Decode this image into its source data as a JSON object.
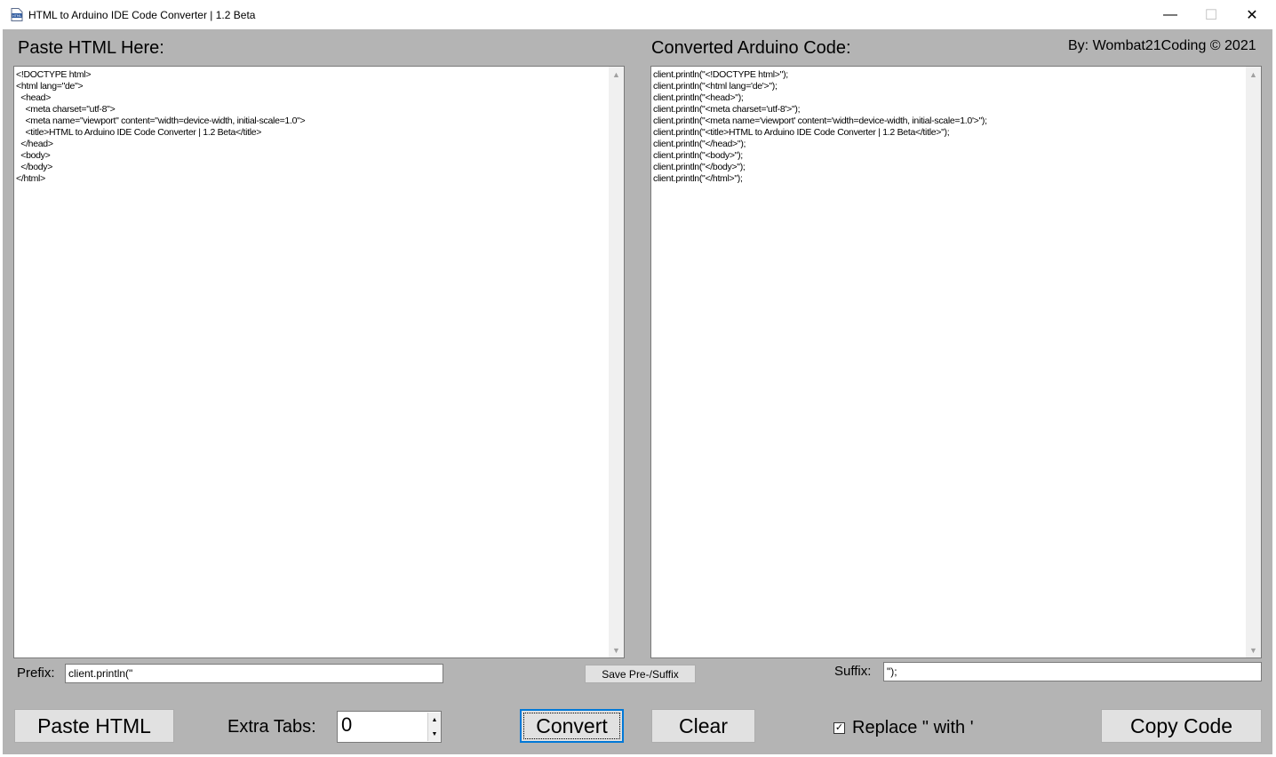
{
  "window": {
    "title": "HTML to Arduino IDE Code Converter | 1.2 Beta",
    "minimize_glyph": "—",
    "maximize_glyph": "☐",
    "close_glyph": "✕"
  },
  "labels": {
    "paste_html_here": "Paste HTML Here:",
    "converted_code": "Converted Arduino Code:",
    "byline": "By: Wombat21Coding ©  2021",
    "prefix": "Prefix:",
    "suffix": "Suffix:",
    "extra_tabs": "Extra Tabs:"
  },
  "html_input": {
    "lines": [
      "<!DOCTYPE html>",
      "<html lang=\"de\">",
      "  <head>",
      "    <meta charset=\"utf-8\">",
      "    <meta name=\"viewport\" content=\"width=device-width, initial-scale=1.0\">",
      "    <title>HTML to Arduino IDE Code Converter | 1.2 Beta</title>",
      "  </head>",
      "  <body>",
      "  </body>",
      "</html>"
    ]
  },
  "converted_output": {
    "lines": [
      "client.println(\"<!DOCTYPE html>\");",
      "client.println(\"<html lang='de'>\");",
      "client.println(\"<head>\");",
      "client.println(\"<meta charset='utf-8'>\");",
      "client.println(\"<meta name='viewport' content='width=device-width, initial-scale=1.0'>\");",
      "client.println(\"<title>HTML to Arduino IDE Code Converter | 1.2 Beta</title>\");",
      "client.println(\"</head>\");",
      "client.println(\"<body>\");",
      "client.println(\"</body>\");",
      "client.println(\"</html>\");"
    ]
  },
  "fields": {
    "prefix_value": "client.println(\"",
    "suffix_value": "\");",
    "extra_tabs_value": "0"
  },
  "buttons": {
    "save_presuffix": "Save Pre-/Suffix",
    "paste_html": "Paste HTML",
    "convert": "Convert",
    "clear": "Clear",
    "copy_code": "Copy Code"
  },
  "options": {
    "replace_quotes_label": "Replace \" with '",
    "replace_quotes_checked": true
  },
  "colors": {
    "client_background": "#b4b4b4",
    "focus_accent": "#0078d7"
  }
}
